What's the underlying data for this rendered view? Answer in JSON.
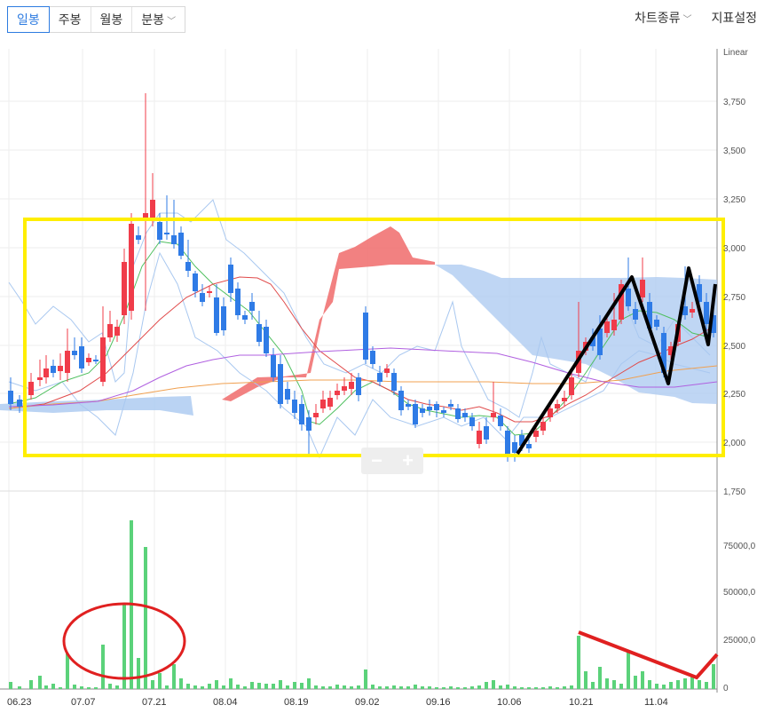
{
  "toolbar": {
    "periods": [
      {
        "label": "일봉",
        "active": true
      },
      {
        "label": "주봉",
        "active": false
      },
      {
        "label": "월봉",
        "active": false
      },
      {
        "label": "분봉",
        "active": false
      }
    ],
    "chart_type_label": "차트종류",
    "indicator_settings_label": "지표설정"
  },
  "price_axis": {
    "scale_label": "Linear",
    "ticks": [
      "3,750",
      "3,500",
      "3,250",
      "3,000",
      "2,750",
      "2,500",
      "2,250",
      "2,000",
      "1,750"
    ]
  },
  "volume_axis": {
    "ticks": [
      "75000,0",
      "50000,0",
      "25000,0",
      "0"
    ]
  },
  "date_axis": {
    "ticks": [
      "06.23",
      "07.07",
      "07.21",
      "08.04",
      "08.19",
      "09.02",
      "09.16",
      "10.06",
      "10.21",
      "11.04"
    ]
  },
  "colors": {
    "up": "#f03c4a",
    "down": "#2f7be6",
    "volume": "#5bd27a",
    "cloud_bull": "#f06b6b",
    "cloud_bear": "#a9c8f0",
    "highlight_box": "#ffee00",
    "annotation_red": "#e02020",
    "annotation_black": "#000000"
  },
  "icons": {
    "zoom_out": "minus-icon",
    "zoom_in": "plus-icon",
    "dropdown": "chevron-down-icon"
  }
}
